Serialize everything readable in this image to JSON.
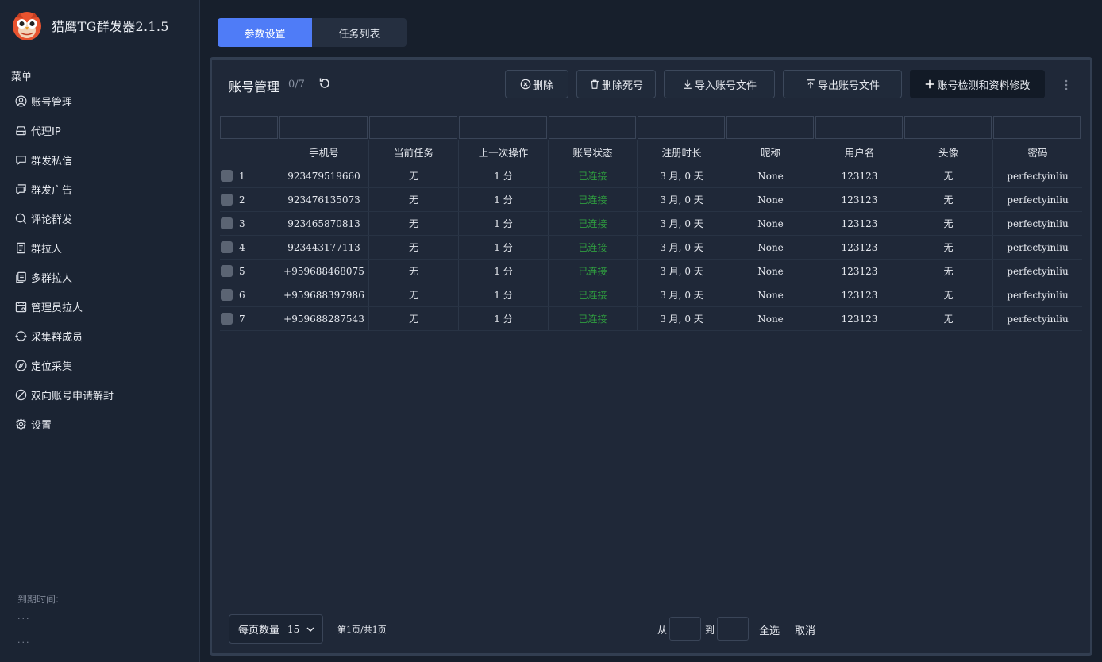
{
  "app": {
    "title": "猎鹰TG群发器2.1.5"
  },
  "sidebar": {
    "menu_label": "菜单",
    "items": [
      {
        "label": "账号管理",
        "icon": "user-circle-icon"
      },
      {
        "label": "代理IP",
        "icon": "server-icon"
      },
      {
        "label": "群发私信",
        "icon": "message-icon"
      },
      {
        "label": "群发广告",
        "icon": "messages-icon"
      },
      {
        "label": "评论群发",
        "icon": "comment-search-icon"
      },
      {
        "label": "群拉人",
        "icon": "document-icon"
      },
      {
        "label": "多群拉人",
        "icon": "documents-icon"
      },
      {
        "label": "管理员拉人",
        "icon": "calendar-user-icon"
      },
      {
        "label": "采集群成员",
        "icon": "target-icon"
      },
      {
        "label": "定位采集",
        "icon": "compass-icon"
      },
      {
        "label": "双向账号申请解封",
        "icon": "ban-icon"
      },
      {
        "label": "设置",
        "icon": "gear-icon"
      }
    ],
    "expire_label": "到期时间:",
    "dots1": "...",
    "dots2": "..."
  },
  "tabs": [
    {
      "label": "参数设置",
      "active": true
    },
    {
      "label": "任务列表",
      "active": false
    }
  ],
  "panel": {
    "title": "账号管理",
    "count": "0/7",
    "buttons": {
      "delete": "删除",
      "delete_dead": "删除死号",
      "import": "导入账号文件",
      "export": "导出账号文件",
      "check": "账号检测和资料修改"
    }
  },
  "table": {
    "headers": [
      "",
      "手机号",
      "当前任务",
      "上一次操作",
      "账号状态",
      "注册时长",
      "昵称",
      "用户名",
      "头像",
      "密码"
    ],
    "rows": [
      {
        "idx": "1",
        "phone": "923479519660",
        "task": "无",
        "last": "1 分",
        "status": "已连接",
        "reg": "3 月, 0 天",
        "nick": "None",
        "user": "123123",
        "avatar": "无",
        "pwd": "perfectyinliu"
      },
      {
        "idx": "2",
        "phone": "923476135073",
        "task": "无",
        "last": "1 分",
        "status": "已连接",
        "reg": "3 月, 0 天",
        "nick": "None",
        "user": "123123",
        "avatar": "无",
        "pwd": "perfectyinliu"
      },
      {
        "idx": "3",
        "phone": "923465870813",
        "task": "无",
        "last": "1 分",
        "status": "已连接",
        "reg": "3 月, 0 天",
        "nick": "None",
        "user": "123123",
        "avatar": "无",
        "pwd": "perfectyinliu"
      },
      {
        "idx": "4",
        "phone": "923443177113",
        "task": "无",
        "last": "1 分",
        "status": "已连接",
        "reg": "3 月, 0 天",
        "nick": "None",
        "user": "123123",
        "avatar": "无",
        "pwd": "perfectyinliu"
      },
      {
        "idx": "5",
        "phone": "+959688468075",
        "task": "无",
        "last": "1 分",
        "status": "已连接",
        "reg": "3 月, 0 天",
        "nick": "None",
        "user": "123123",
        "avatar": "无",
        "pwd": "perfectyinliu"
      },
      {
        "idx": "6",
        "phone": "+959688397986",
        "task": "无",
        "last": "1 分",
        "status": "已连接",
        "reg": "3 月, 0 天",
        "nick": "None",
        "user": "123123",
        "avatar": "无",
        "pwd": "perfectyinliu"
      },
      {
        "idx": "7",
        "phone": "+959688287543",
        "task": "无",
        "last": "1 分",
        "status": "已连接",
        "reg": "3 月, 0 天",
        "nick": "None",
        "user": "123123",
        "avatar": "无",
        "pwd": "perfectyinliu"
      }
    ]
  },
  "footer": {
    "pagesize_label": "每页数量",
    "pagesize_value": "15",
    "page_info": "第1页/共1页",
    "from_label": "从",
    "to_label": "到",
    "select_all": "全选",
    "cancel": "取消"
  },
  "colors": {
    "accent": "#4f7cf7",
    "status_connected": "#2f9d3f",
    "background": "#171f2c",
    "panel": "#1f2838"
  }
}
